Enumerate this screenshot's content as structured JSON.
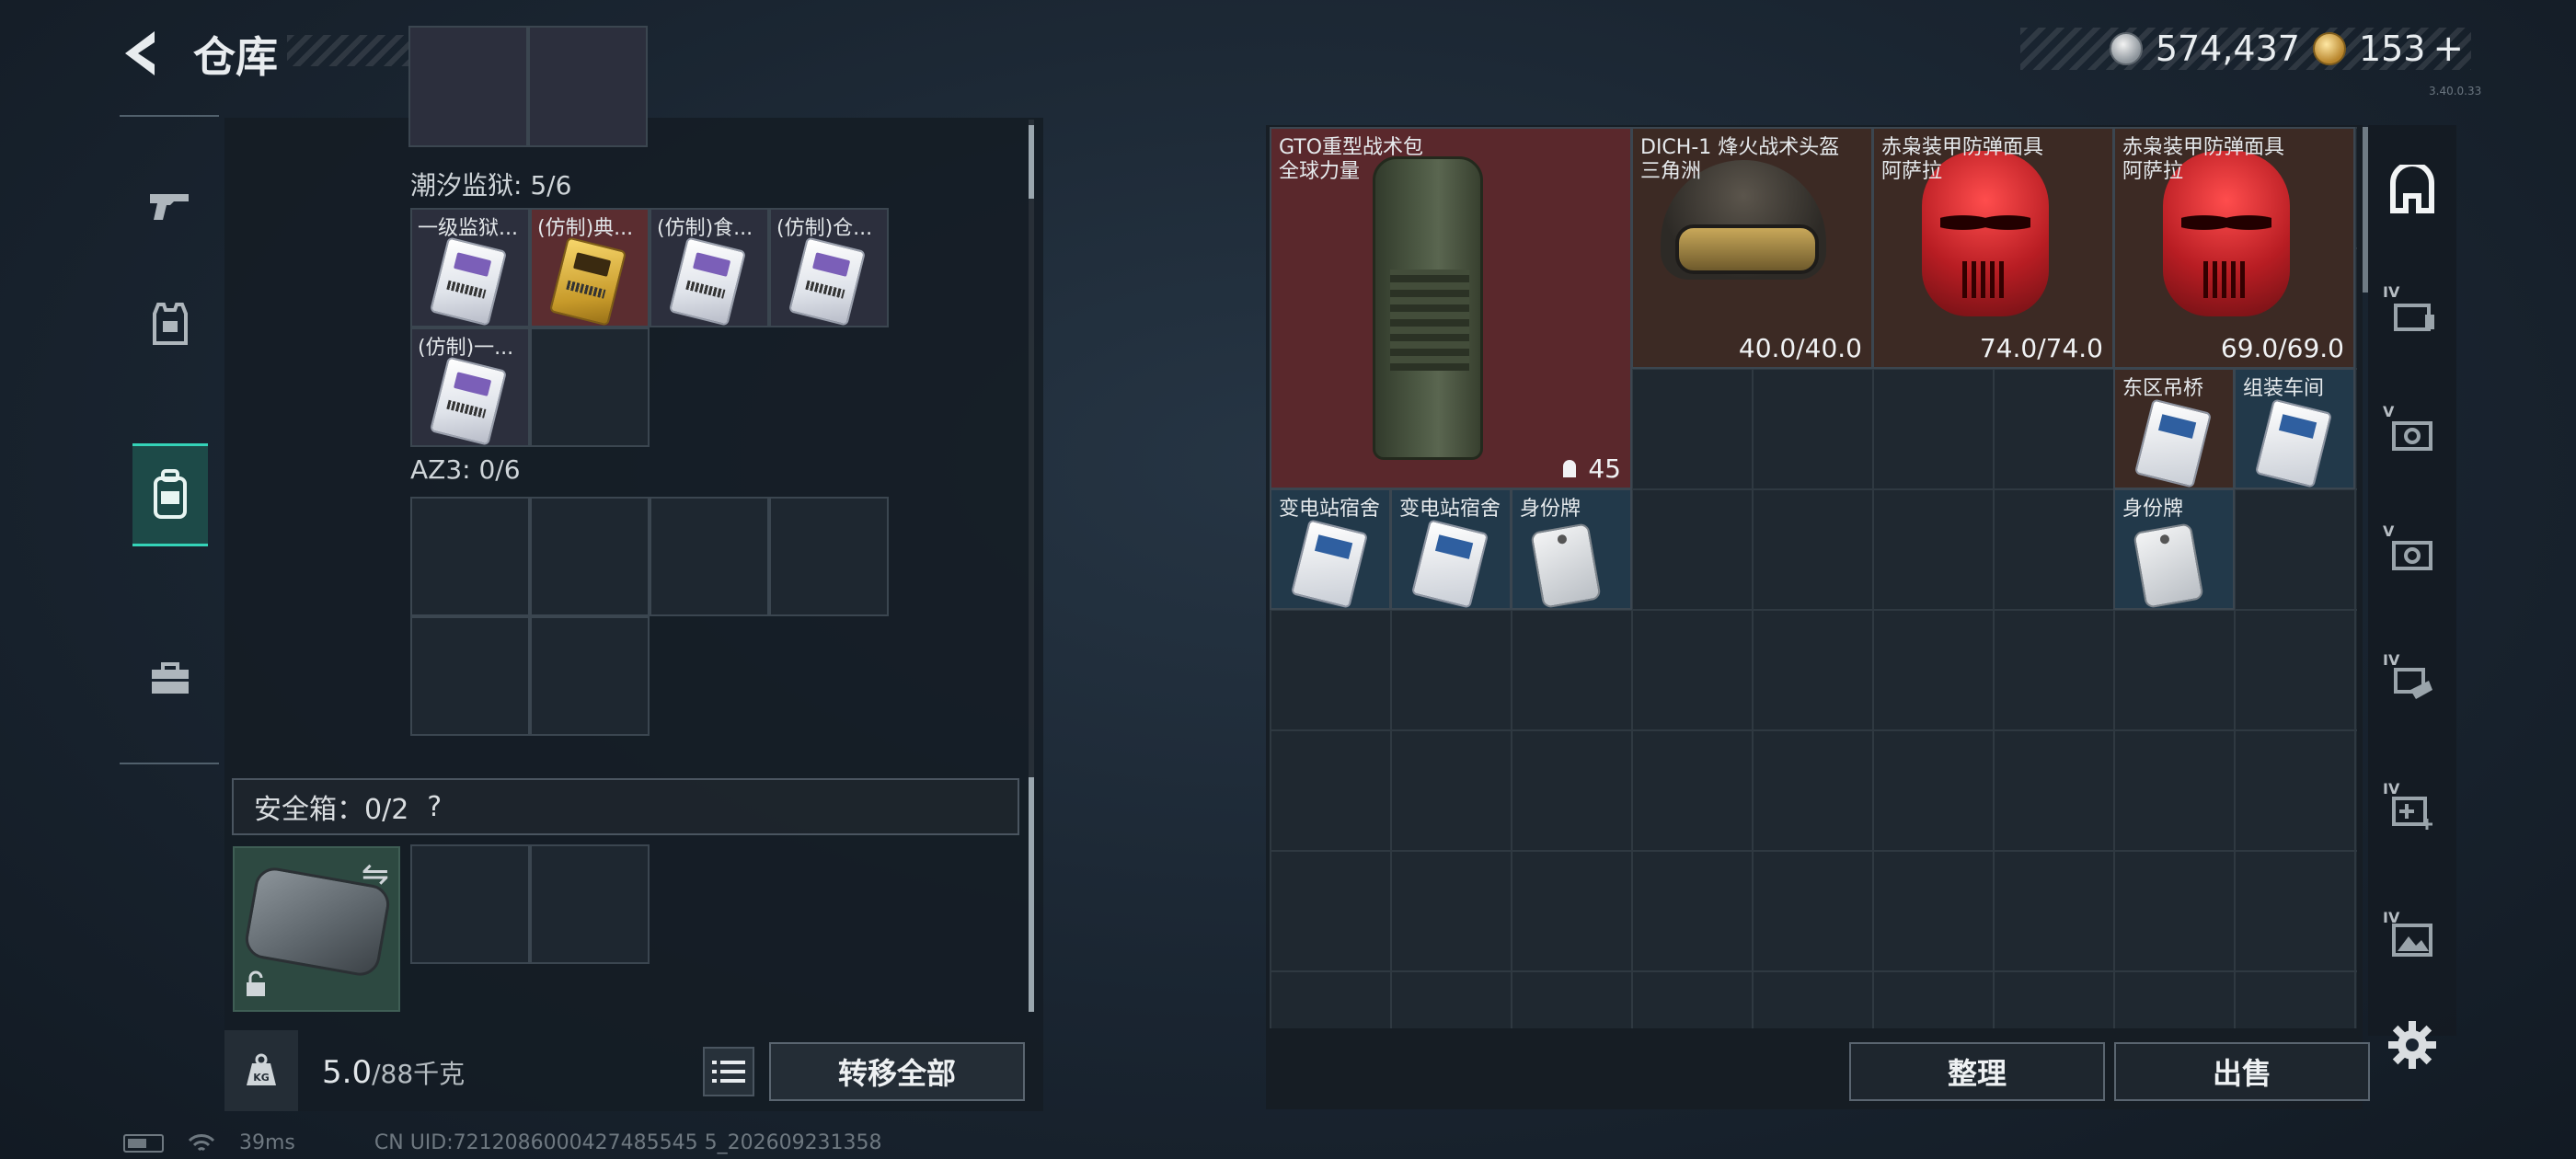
{
  "header": {
    "title": "仓库",
    "currency": {
      "silver": "574,437",
      "gold": "153",
      "gold_plus": "+"
    },
    "version": "3.40.0.33"
  },
  "left_nav": {
    "items": [
      {
        "name": "weapons",
        "icon": "pistol-icon"
      },
      {
        "name": "equipment",
        "icon": "armor-vest-icon"
      },
      {
        "name": "backpack",
        "icon": "backpack-icon",
        "active": true
      },
      {
        "name": "toolbox",
        "icon": "briefcase-icon"
      }
    ]
  },
  "storage": {
    "sections": [
      {
        "label": "潮汐监狱: 5/6",
        "items": [
          {
            "label": "一级监狱..."
          },
          {
            "label": "(仿制)典..."
          },
          {
            "label": "(仿制)食..."
          },
          {
            "label": "(仿制)仓..."
          },
          {
            "label": "(仿制)一..."
          }
        ]
      },
      {
        "label": "AZ3: 0/6"
      }
    ],
    "safe_box": {
      "label": "安全箱：0/2",
      "help": "?",
      "swap_icon": "swap-arrows-icon",
      "lock_icon": "lock-icon"
    },
    "weight": {
      "current": "5.0",
      "max": "/88千克",
      "icon": "kg-weight-icon"
    },
    "transfer_all": "转移全部"
  },
  "inventory": {
    "items": [
      {
        "name1": "GTO重型战术包",
        "name2": "全球力量",
        "capacity": "45"
      },
      {
        "name1": "DICH-1 烽火战术头盔",
        "name2": "三角洲",
        "durability": "40.0/40.0"
      },
      {
        "name1": "赤枭装甲防弹面具",
        "name2": "阿萨拉",
        "durability": "74.0/74.0"
      },
      {
        "name1": "赤枭装甲防弹面具",
        "name2": "阿萨拉",
        "durability": "69.0/69.0"
      },
      {
        "name1": "东区吊桥"
      },
      {
        "name1": "组装车间"
      },
      {
        "name1": "变电站宿舍"
      },
      {
        "name1": "变电站宿舍"
      },
      {
        "name1": "身份牌"
      },
      {
        "name1": "身份牌"
      }
    ],
    "sort_label": "整理",
    "sell_label": "出售"
  },
  "right_nav": {
    "items": [
      {
        "icon": "bag-main-icon",
        "level": ""
      },
      {
        "icon": "folder-stack-icon",
        "level": "IV"
      },
      {
        "icon": "gear-box-icon",
        "level": "V"
      },
      {
        "icon": "gear-box-icon",
        "level": "V"
      },
      {
        "icon": "hand-box-icon",
        "level": "IV"
      },
      {
        "icon": "medkit-icon",
        "level": "IV"
      },
      {
        "icon": "landscape-icon",
        "level": "IV"
      }
    ],
    "settings_icon": "settings-gear-icon"
  },
  "status_bar": {
    "ping": "39ms",
    "uid": "CN UID:7212086000427485545 5_202609231358"
  }
}
